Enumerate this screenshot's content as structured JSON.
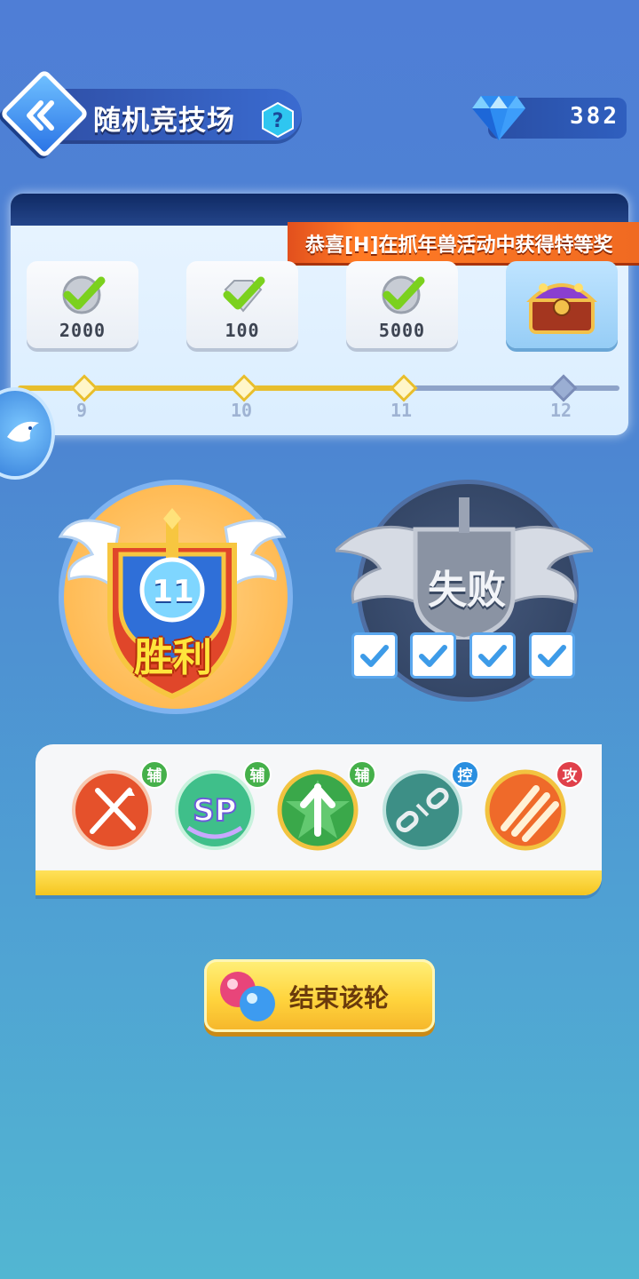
{
  "header": {
    "title": "随机竞技场",
    "help_symbol": "?",
    "gem_count": "382",
    "back_icon": "double-chevron-left-icon",
    "gem_icon": "diamond-icon"
  },
  "announcement": "恭喜[H]在抓年兽活动中获得特等奖",
  "rewards": [
    {
      "value": "2000",
      "claimed": true,
      "win": "9"
    },
    {
      "value": "100",
      "claimed": true,
      "win": "10"
    },
    {
      "value": "5000",
      "claimed": true,
      "win": "11"
    },
    {
      "value": "",
      "claimed": false,
      "win": "12",
      "icon": "treasure-chest-icon"
    }
  ],
  "progress": {
    "current_wins": 11,
    "max_wins": 12
  },
  "result": {
    "wins": "11",
    "win_label": "胜利",
    "lose_label": "失败",
    "losses_marked": 4
  },
  "skills": [
    {
      "icon": "sword-buff-icon",
      "tag": "辅",
      "tag_color": "#45b04a"
    },
    {
      "icon": "sp-orb-icon",
      "tag": "辅",
      "tag_color": "#45b04a"
    },
    {
      "icon": "arrow-up-star-icon",
      "tag": "辅",
      "tag_color": "#45b04a"
    },
    {
      "icon": "chain-break-icon",
      "tag": "控",
      "tag_color": "#2a8fe0"
    },
    {
      "icon": "claw-strike-icon",
      "tag": "攻",
      "tag_color": "#e0404a"
    }
  ],
  "end_button": {
    "label": "结束该轮"
  },
  "colors": {
    "accent_gold": "#e8be2c",
    "banner": "#f06a22",
    "win_text": "#ffe53c"
  }
}
